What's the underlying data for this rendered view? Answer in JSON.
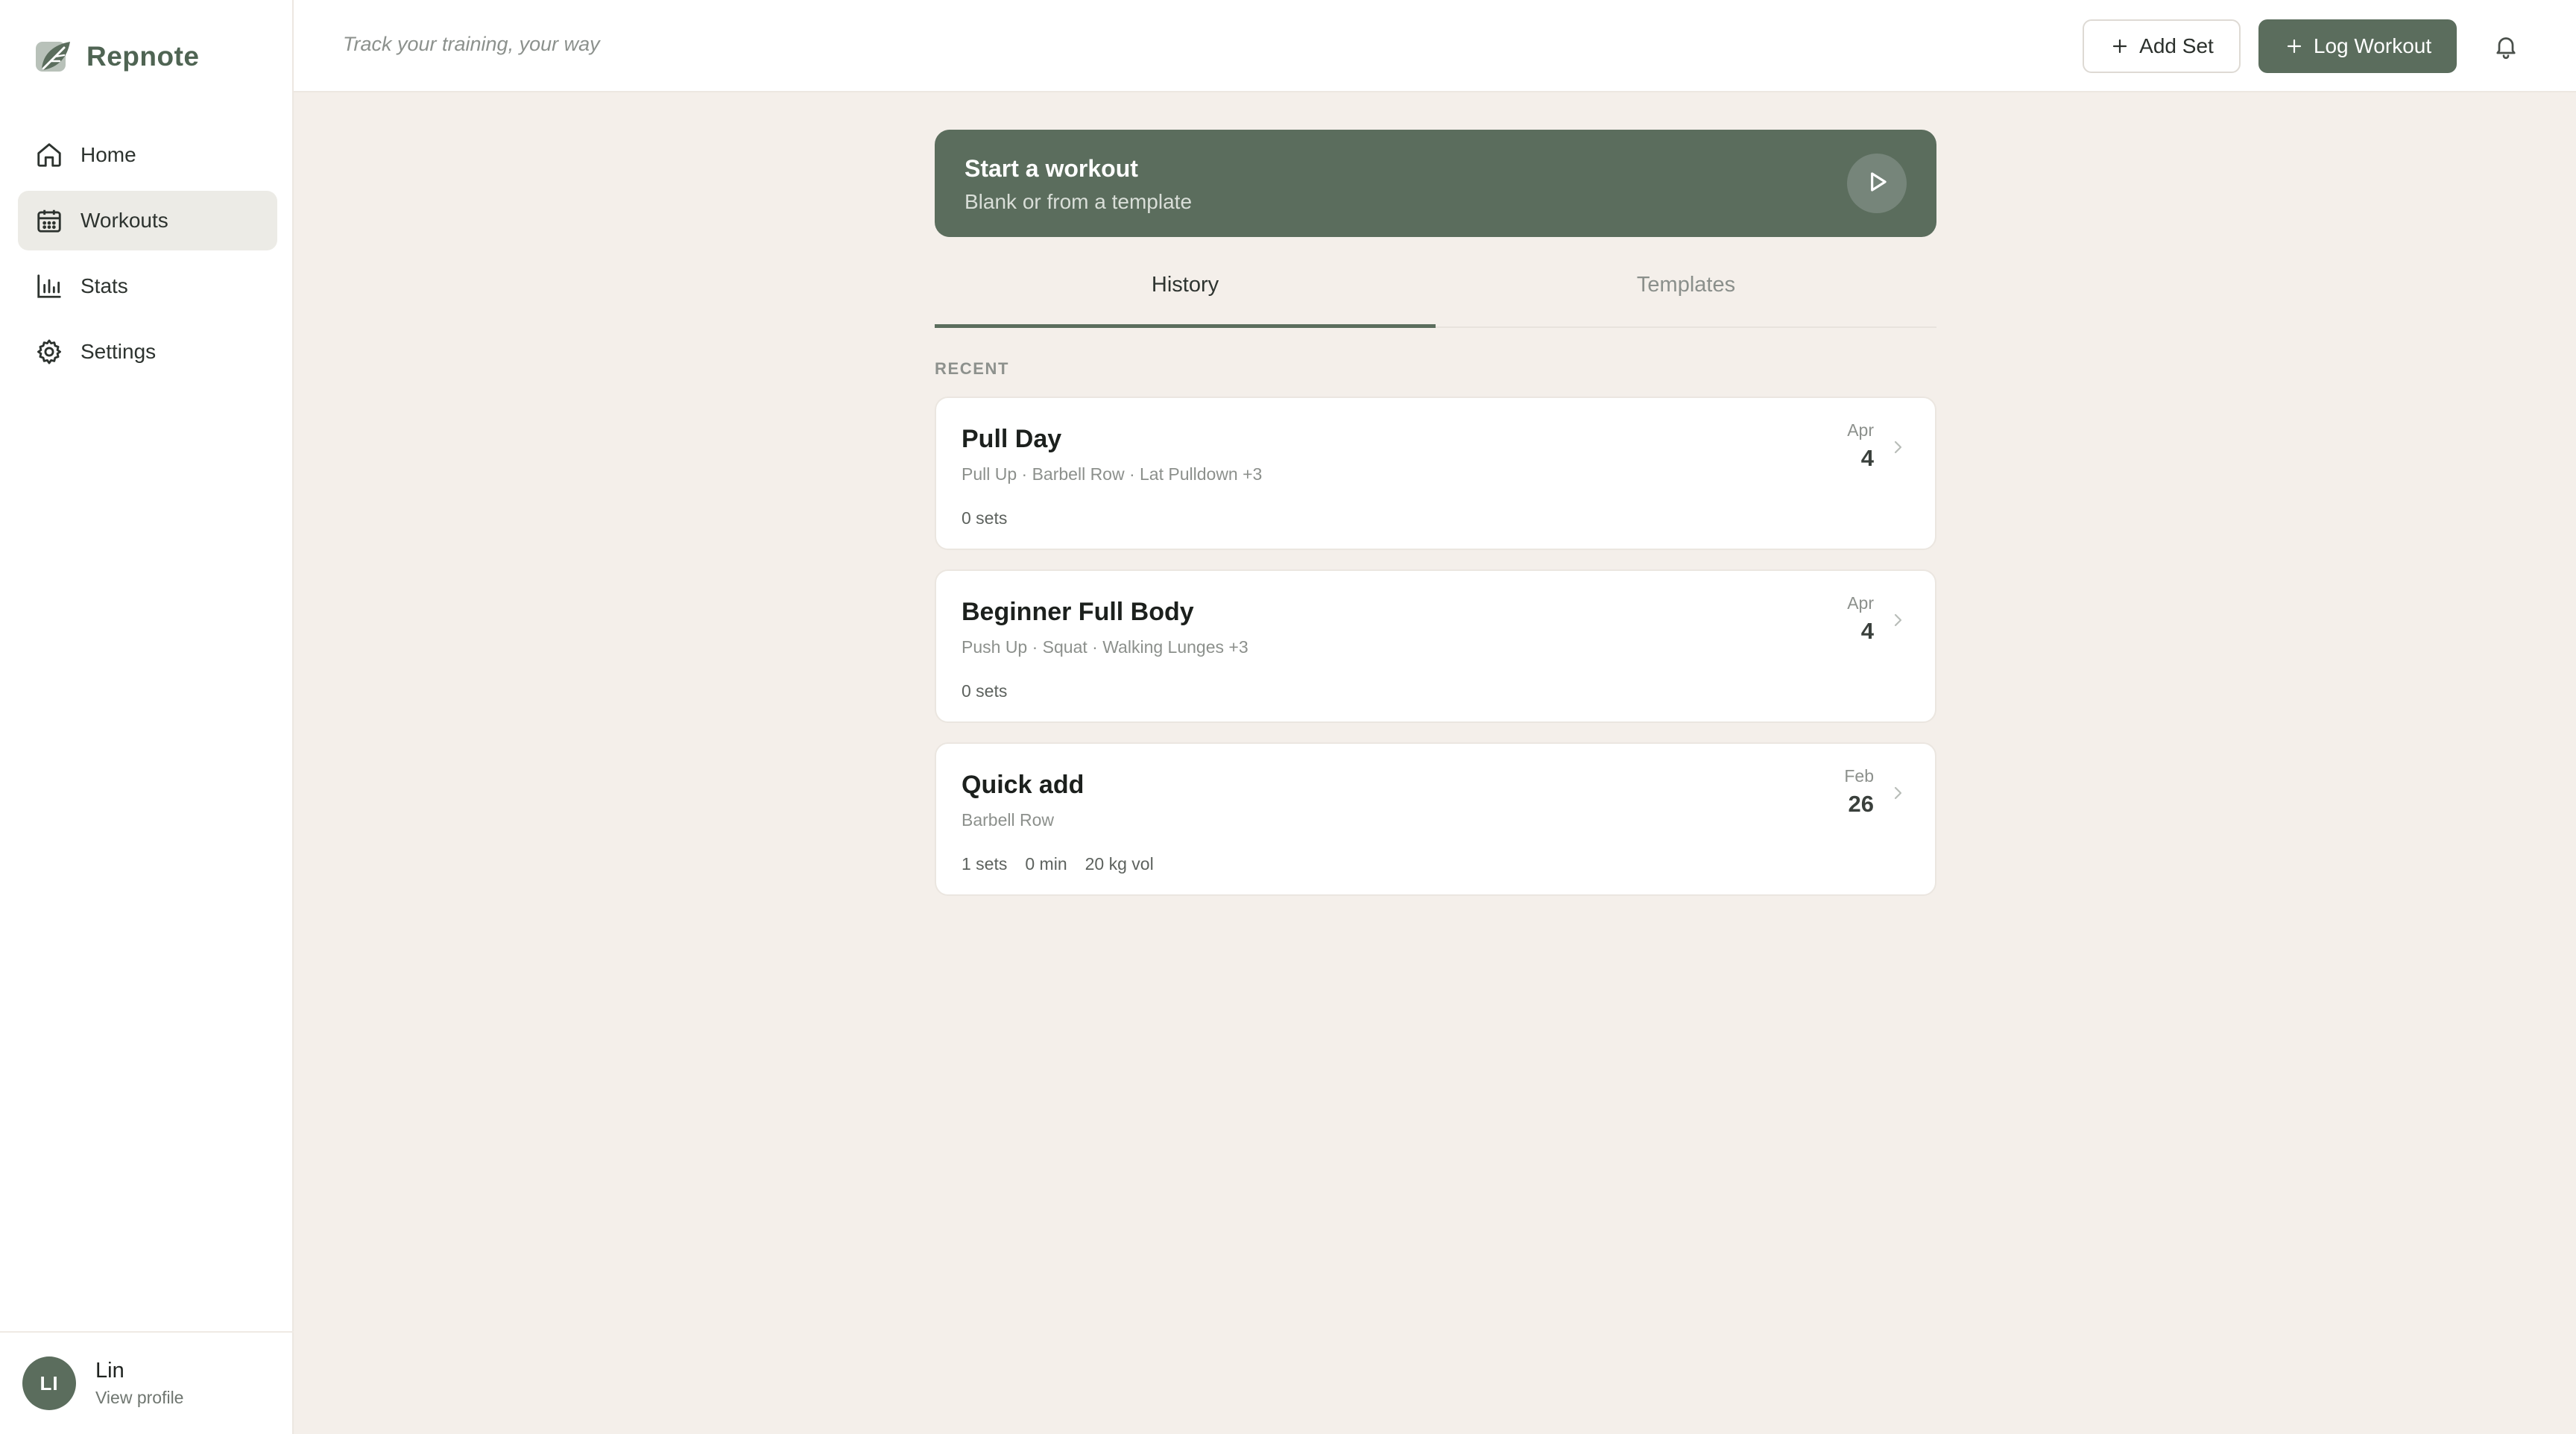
{
  "app": {
    "name": "Repnote",
    "tagline": "Track your training, your way"
  },
  "sidebar": {
    "items": [
      {
        "label": "Home",
        "icon": "home-icon",
        "active": false
      },
      {
        "label": "Workouts",
        "icon": "calendar-icon",
        "active": true
      },
      {
        "label": "Stats",
        "icon": "bar-chart-icon",
        "active": false
      },
      {
        "label": "Settings",
        "icon": "gear-icon",
        "active": false
      }
    ]
  },
  "profile": {
    "initials": "LI",
    "name": "Lin",
    "link": "View profile"
  },
  "header": {
    "add_set_label": "Add Set",
    "log_workout_label": "Log Workout",
    "bell_icon": "bell-icon"
  },
  "start_card": {
    "title": "Start a workout",
    "subtitle": "Blank or from a template",
    "icon": "play-icon"
  },
  "tabs": [
    {
      "label": "History",
      "active": true
    },
    {
      "label": "Templates",
      "active": false
    }
  ],
  "section_label": "RECENT",
  "workouts": [
    {
      "title": "Pull Day",
      "exercises": "Pull Up · Barbell Row · Lat Pulldown +3",
      "stats": [
        "0 sets"
      ],
      "month": "Apr",
      "day": "4"
    },
    {
      "title": "Beginner Full Body",
      "exercises": "Push Up · Squat · Walking Lunges +3",
      "stats": [
        "0 sets"
      ],
      "month": "Apr",
      "day": "4"
    },
    {
      "title": "Quick add",
      "exercises": "Barbell Row",
      "stats": [
        "1 sets",
        "0 min",
        "20 kg vol"
      ],
      "month": "Feb",
      "day": "26"
    }
  ],
  "colors": {
    "accent": "#5b6d5d",
    "background": "#f4efea",
    "surface": "#ffffff"
  }
}
